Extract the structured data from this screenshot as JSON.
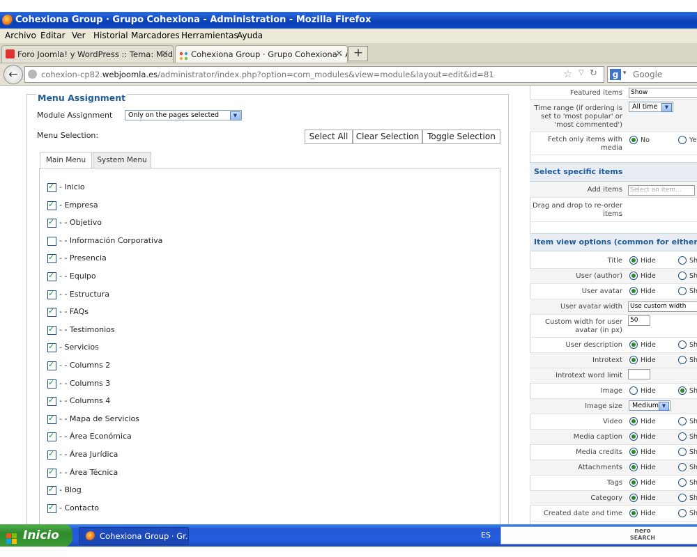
{
  "window": {
    "title": "Cohexiona Group · Grupo Cohexiona - Administration - Mozilla Firefox"
  },
  "menubar": {
    "items": [
      "Archivo",
      "Editar",
      "Ver",
      "Historial",
      "Marcadores",
      "Herramientas",
      "Ayuda"
    ]
  },
  "tabs": [
    {
      "label": "Foro Joomla! y WordPress :: Tema: Mod...",
      "active": false
    },
    {
      "label": "Cohexiona Group · Grupo Cohexiona - A...",
      "active": true
    }
  ],
  "newtab_label": "+",
  "address": {
    "url_prefix": "cohexion-cp82.",
    "url_domain": "webjoomla.es",
    "url_path": "/administrator/index.php?option=com_modules&view=module&layout=edit&id=81"
  },
  "search": {
    "placeholder": "Google"
  },
  "menu_assignment": {
    "legend": "Menu Assignment",
    "module_assignment_label": "Module Assignment",
    "module_assignment_value": "Only on the pages selected",
    "menu_selection_label": "Menu Selection:",
    "buttons": {
      "select_all": "Select All",
      "clear_selection": "Clear Selection",
      "toggle_selection": "Toggle Selection"
    },
    "menu_tabs": [
      "Main Menu",
      "System Menu"
    ],
    "items": [
      {
        "label": "- Inicio",
        "checked": true
      },
      {
        "label": "- Empresa",
        "checked": true
      },
      {
        "label": "- - Objetivo",
        "checked": true
      },
      {
        "label": "- - Información Corporativa",
        "checked": false
      },
      {
        "label": "- - Presencia",
        "checked": true
      },
      {
        "label": "- - Equipo",
        "checked": true
      },
      {
        "label": "- - Estructura",
        "checked": true
      },
      {
        "label": "- - FAQs",
        "checked": true
      },
      {
        "label": "- - Testimonios",
        "checked": true
      },
      {
        "label": "- Servicios",
        "checked": true
      },
      {
        "label": "- - Columns 2",
        "checked": true
      },
      {
        "label": "- - Columns 3",
        "checked": true
      },
      {
        "label": "- - Columns 4",
        "checked": true
      },
      {
        "label": "- - Mapa de Servicios",
        "checked": true
      },
      {
        "label": "- - Área Económica",
        "checked": true
      },
      {
        "label": "- - Área Jurídica",
        "checked": true
      },
      {
        "label": "- - Área Técnica",
        "checked": true
      },
      {
        "label": "- Blog",
        "checked": true
      },
      {
        "label": "- Contacto",
        "checked": true
      }
    ]
  },
  "right_panel": {
    "featured_items": {
      "label": "Featured items",
      "value": "Show"
    },
    "time_range": {
      "label_lines": [
        "Time range (if ordering is",
        "set to 'most popular' or",
        "'most commented')"
      ],
      "value": "All time"
    },
    "fetch_only": {
      "label_lines": [
        "Fetch only items with",
        "media"
      ],
      "opt_no": "No",
      "opt_yes": "Ye"
    },
    "select_specific_header": "Select specific items",
    "add_items": {
      "label": "Add items",
      "placeholder": "Select an item..."
    },
    "drag_drop": {
      "label_lines": [
        "Drag and drop to re-order",
        "items"
      ]
    },
    "item_view_header": "Item view options (common for either sou",
    "opt_hide": "Hide",
    "opt_show": "Sh",
    "radio_rows": [
      {
        "label": "Title",
        "hide": true
      },
      {
        "label": "User (author)",
        "hide": true
      },
      {
        "label": "User avatar",
        "hide": true
      }
    ],
    "user_avatar_width": {
      "label": "User avatar width",
      "value": "Use custom width"
    },
    "custom_width": {
      "label_lines": [
        "Custom width for user",
        "avatar (in px)"
      ],
      "value": "50"
    },
    "radio_rows2": [
      {
        "label": "User description",
        "hide": true
      },
      {
        "label": "Introtext",
        "hide": true
      }
    ],
    "introtext_limit": {
      "label": "Introtext word limit",
      "value": ""
    },
    "image": {
      "label": "Image",
      "hide": false
    },
    "image_size": {
      "label": "Image size",
      "value": "Medium"
    },
    "radio_rows3": [
      {
        "label": "Video",
        "hide": true
      },
      {
        "label": "Media caption",
        "hide": true
      },
      {
        "label": "Media credits",
        "hide": true
      },
      {
        "label": "Attachments",
        "hide": true
      },
      {
        "label": "Tags",
        "hide": true
      },
      {
        "label": "Category",
        "hide": true
      },
      {
        "label": "Created date and time",
        "hide": true
      }
    ]
  },
  "taskbar": {
    "start_label": "Inicio",
    "task_label": "Cohexiona Group · Gr...",
    "language": "ES",
    "nero_line1": "nero",
    "nero_line2": "SEARCH"
  }
}
